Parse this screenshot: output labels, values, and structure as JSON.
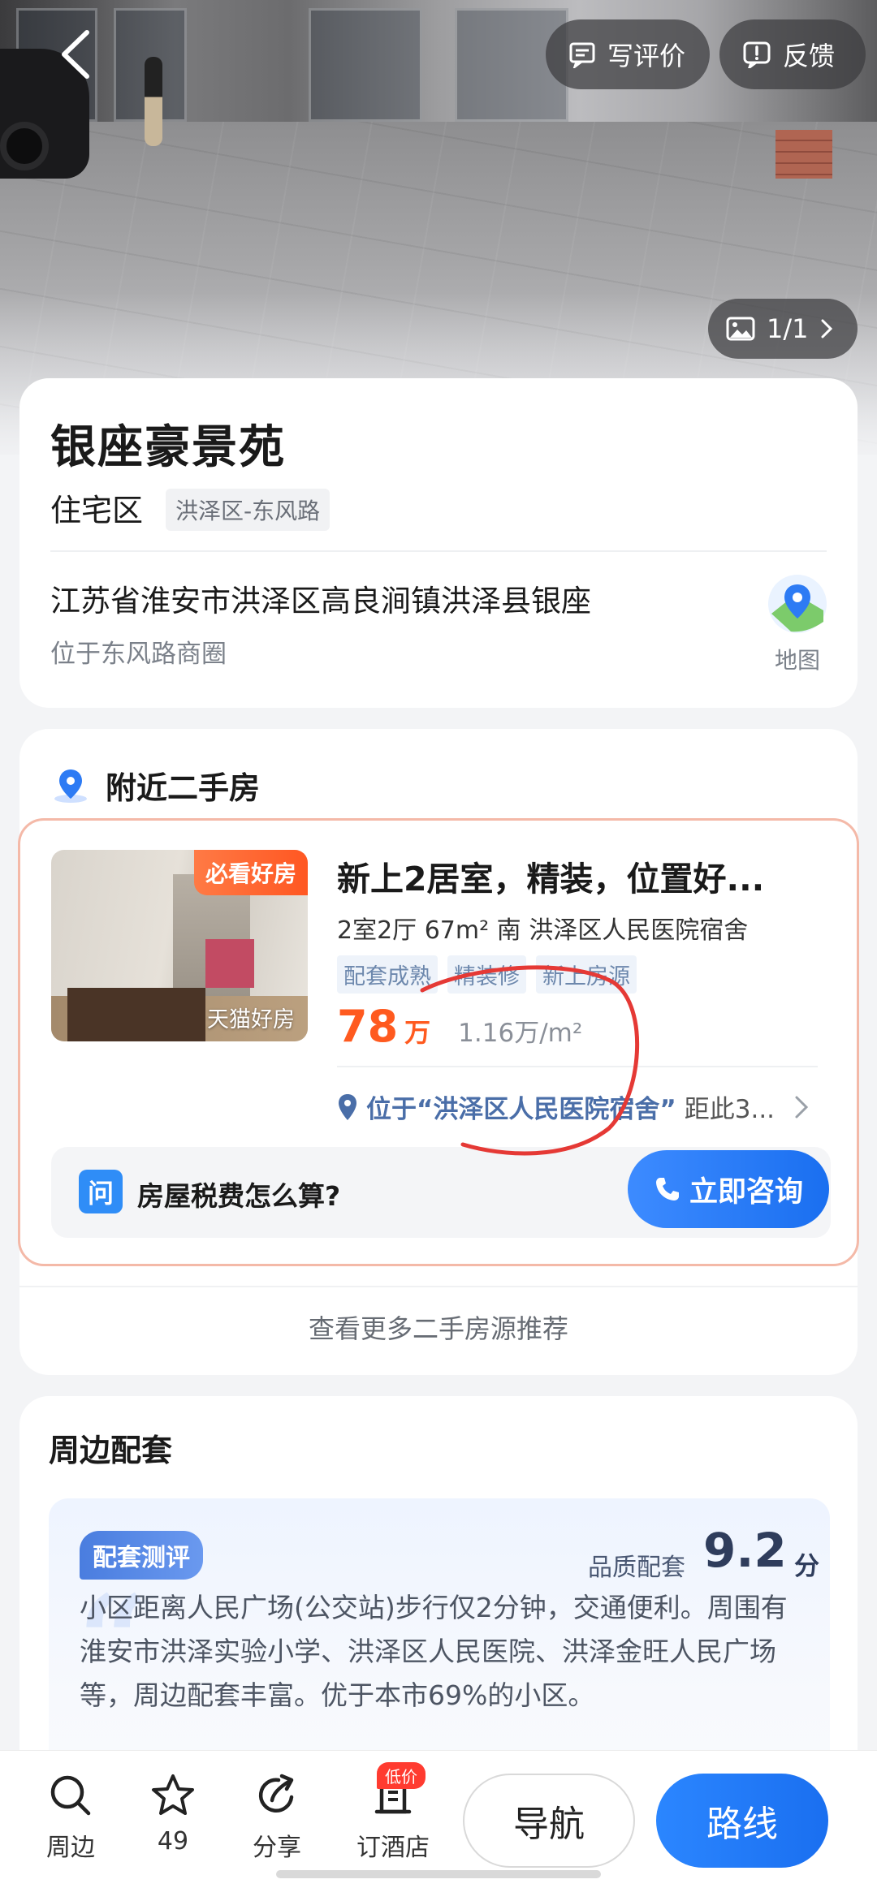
{
  "hero": {
    "photo_counter": "1/1",
    "write_review_label": "写评价",
    "feedback_label": "反馈"
  },
  "poi": {
    "name": "银座豪景苑",
    "type": "住宅区",
    "area_tag": "洪泽区-东风路",
    "address": "江苏省淮安市洪泽区高良涧镇洪泽县银座",
    "business_area": "位于东风路商圈",
    "map_label": "地图"
  },
  "nearby": {
    "section_title": "附近二手房",
    "listing": {
      "badge_must": "必看好房",
      "badge_source": "天猫好房",
      "title": "新上2居室，精装，位置好...",
      "spec": "2室2厅  67m²  南  洪泽区人民医院宿舍",
      "tags": [
        "配套成熟",
        "精装修",
        "新上房源"
      ],
      "price": "78",
      "price_unit": "万",
      "price_per_sqm": "1.16万/m²",
      "location_highlight": "位于“洪泽区人民医院宿舍”",
      "location_distance": "距此3..."
    },
    "ask": {
      "icon_char": "问",
      "question": "房屋税费怎么算?",
      "consult_label": "立即咨询"
    },
    "more_link": "查看更多二手房源推荐"
  },
  "around": {
    "title": "周边配套",
    "eval_tag": "配套测评",
    "score_label": "品质配套",
    "score_value": "9.2",
    "score_unit": "分",
    "description": "小区距离人民广场(公交站)步行仅2分钟，交通便利。周围有淮安市洪泽实验小学、洪泽区人民医院、洪泽金旺人民广场等，周边配套丰富。优于本市69%的小区。"
  },
  "bottom_bar": {
    "nearby_label": "周边",
    "favorites_count": "49",
    "share_label": "分享",
    "hotel_label": "订酒店",
    "hotel_badge": "低价",
    "navigate_label": "导航",
    "route_label": "路线"
  },
  "colors": {
    "accent_blue": "#1a6ff0",
    "price_orange": "#ff5a1f",
    "listing_border": "#f4b9a8",
    "annotation_red": "#e53935"
  }
}
